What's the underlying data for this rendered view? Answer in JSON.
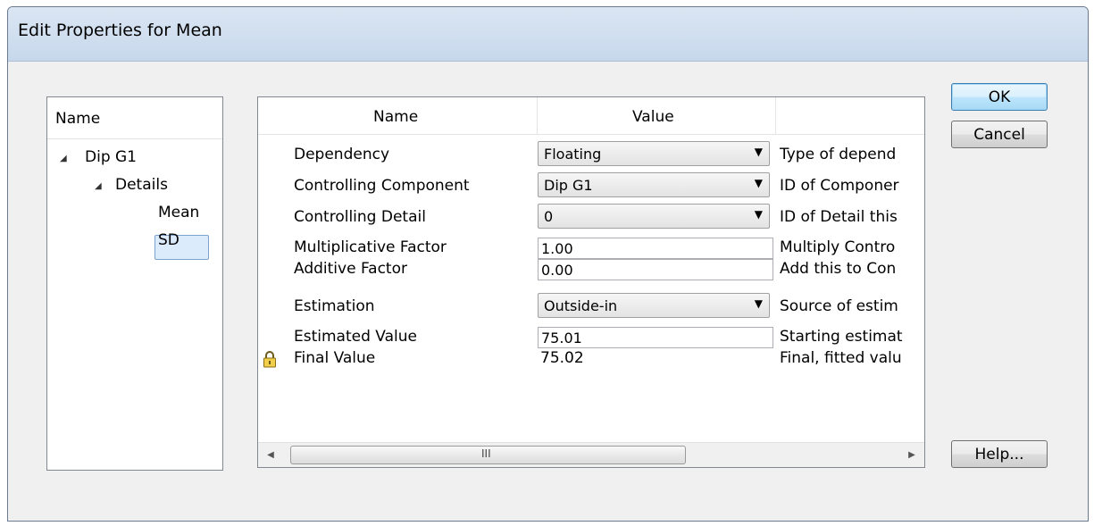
{
  "window": {
    "title": "Edit Properties for Mean"
  },
  "tree": {
    "header": "Name",
    "nodes": {
      "root": "Dip G1",
      "details": "Details",
      "mean": "Mean",
      "sd": "SD"
    },
    "selected": "Mean"
  },
  "grid": {
    "headers": {
      "name": "Name",
      "value": "Value"
    },
    "rows": [
      {
        "name": "Dependency",
        "value": "Floating",
        "desc": "Type of depend",
        "editor": "combo"
      },
      {
        "name": "Controlling Component",
        "value": "Dip G1",
        "desc": "ID of Componer",
        "editor": "combo"
      },
      {
        "name": "Controlling Detail",
        "value": "0",
        "desc": "ID of Detail this",
        "editor": "combo"
      },
      {
        "name": "Multiplicative Factor",
        "value": "1.00",
        "desc": "Multiply Contro",
        "editor": "text"
      },
      {
        "name": "Additive Factor",
        "value": "0.00",
        "desc": "Add this to Con",
        "editor": "text"
      },
      {
        "name": "Estimation",
        "value": "Outside-in",
        "desc": "Source of estim",
        "editor": "combo"
      },
      {
        "name": "Estimated Value",
        "value": "75.01",
        "desc": "Starting estimat",
        "editor": "text"
      },
      {
        "name": "Final Value",
        "value": "75.02",
        "desc": "Final, fitted valu",
        "editor": "readonly",
        "locked": true
      }
    ],
    "scroll_grip": "III"
  },
  "buttons": {
    "ok": "OK",
    "cancel": "Cancel",
    "help": "Help..."
  }
}
